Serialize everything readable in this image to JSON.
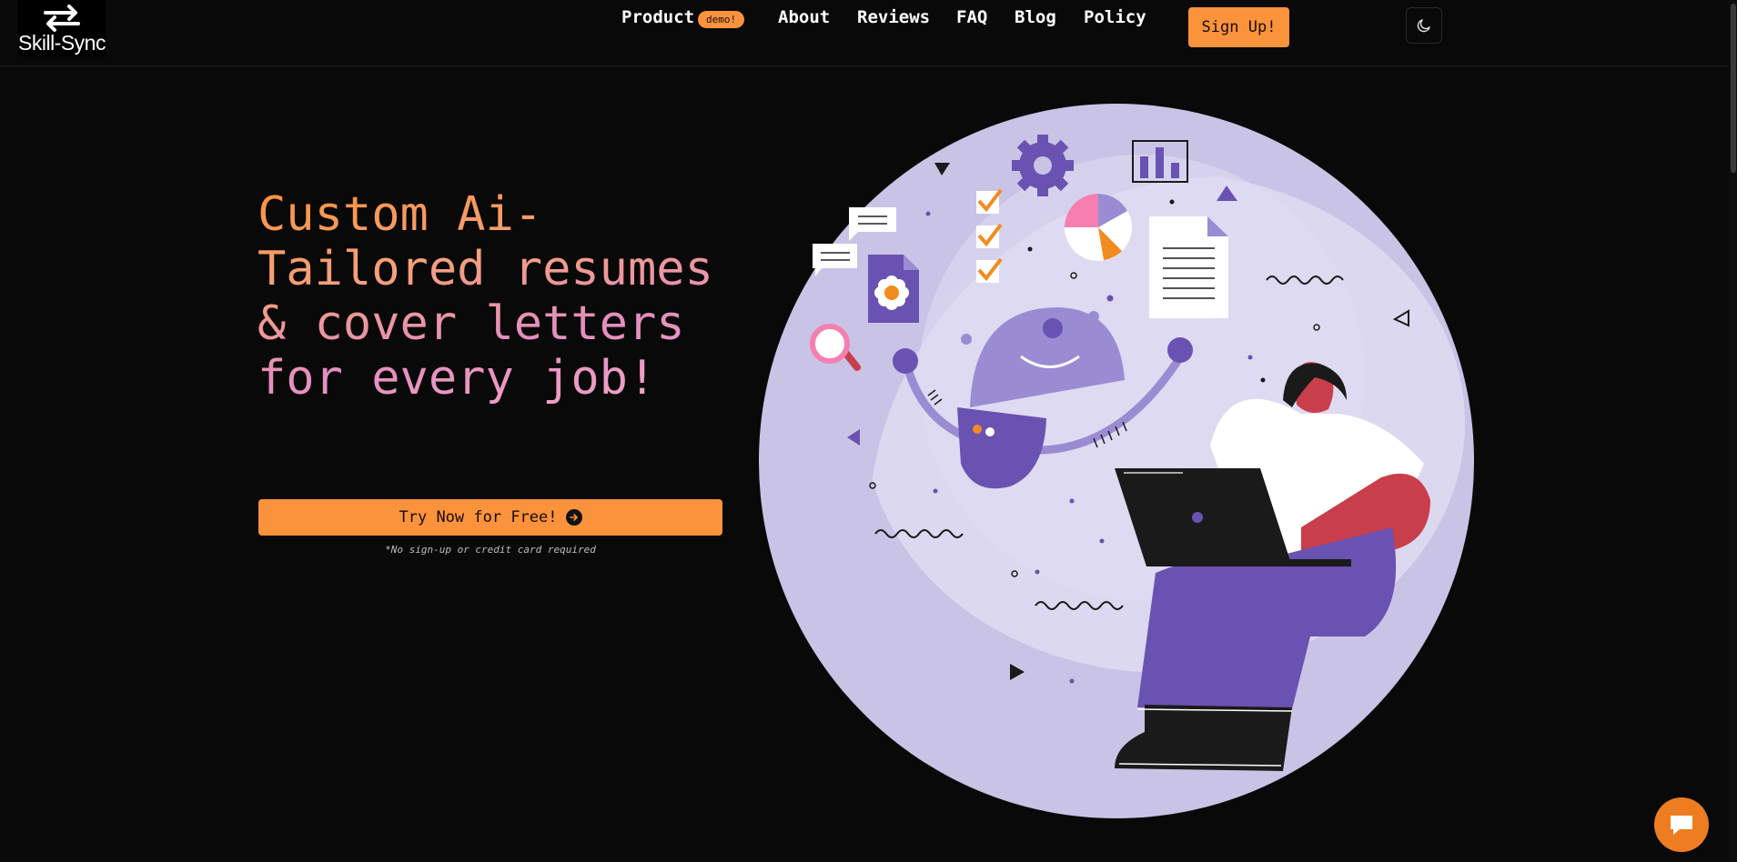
{
  "brand": {
    "name": "Skill-Sync",
    "logo_icon": "swap-arrows-icon"
  },
  "nav": {
    "items": [
      "Product",
      "About",
      "Reviews",
      "FAQ",
      "Blog",
      "Policy"
    ],
    "product_badge": "demo!",
    "signup_label": "Sign Up!",
    "theme_icon": "moon-icon"
  },
  "hero": {
    "title": "Custom Ai-Tailored resumes & cover letters for every job!",
    "cta_label": "Try Now for Free!",
    "cta_icon": "arrow-right-circle-icon",
    "note": "*No sign-up or credit card required",
    "illustration": "woman-with-laptop-and-robot-illustration"
  },
  "chat": {
    "icon": "chat-bubble-icon"
  },
  "colors": {
    "background": "#0a0909",
    "accent": "#fb923c",
    "illustration_circle": "#c8c2e6",
    "illustration_purple": "#6a52b2",
    "title_gradient": [
      "#fb923c",
      "#e48ec0"
    ]
  }
}
